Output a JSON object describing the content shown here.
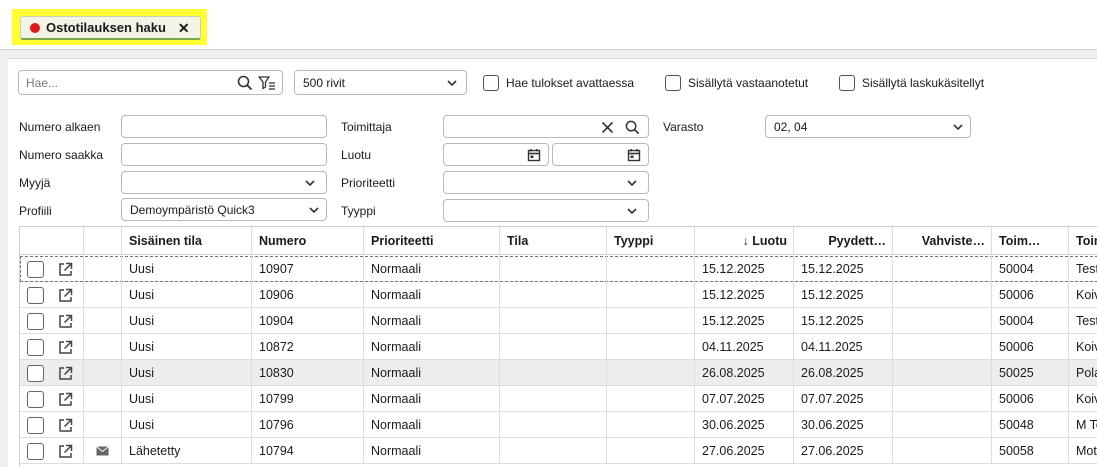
{
  "tab": {
    "label": "Ostotilauksen haku",
    "close": "✕"
  },
  "filters": {
    "search_placeholder": "Hae...",
    "rows_select": "500 rivit",
    "chk_fetch_on_open": "Hae tulokset avattaessa",
    "chk_include_received": "Sisällytä vastaanotetut",
    "chk_include_invoiced": "Sisällytä laskukäsitellyt",
    "number_from_label": "Numero alkaen",
    "number_to_label": "Numero saakka",
    "seller_label": "Myyjä",
    "profile_label": "Profiili",
    "profile_value": "Demoympäristö Quick3",
    "supplier_label": "Toimittaja",
    "created_label": "Luotu",
    "priority_label": "Prioriteetti",
    "type_label": "Tyyppi",
    "warehouse_label": "Varasto",
    "warehouse_value": "02, 04"
  },
  "table": {
    "headers": {
      "internal_status": "Sisäinen tila",
      "number": "Numero",
      "priority": "Prioriteetti",
      "status": "Tila",
      "type": "Tyyppi",
      "created": "↓ Luotu",
      "requested": "Pyydett…",
      "confirmed": "Vahviste…",
      "supplier_no": "Toim…",
      "supplier_name": "Toim"
    },
    "rows": [
      {
        "internal_status": "Uusi",
        "number": "10907",
        "priority": "Normaali",
        "created": "15.12.2025",
        "requested": "15.12.2025",
        "supplier_no": "50004",
        "supplier_name": "Test",
        "mail": false
      },
      {
        "internal_status": "Uusi",
        "number": "10906",
        "priority": "Normaali",
        "created": "15.12.2025",
        "requested": "15.12.2025",
        "supplier_no": "50006",
        "supplier_name": "Koiv",
        "mail": false
      },
      {
        "internal_status": "Uusi",
        "number": "10904",
        "priority": "Normaali",
        "created": "15.12.2025",
        "requested": "15.12.2025",
        "supplier_no": "50004",
        "supplier_name": "Test",
        "mail": false
      },
      {
        "internal_status": "Uusi",
        "number": "10872",
        "priority": "Normaali",
        "created": "04.11.2025",
        "requested": "04.11.2025",
        "supplier_no": "50006",
        "supplier_name": "Koiv",
        "mail": false
      },
      {
        "internal_status": "Uusi",
        "number": "10830",
        "priority": "Normaali",
        "created": "26.08.2025",
        "requested": "26.08.2025",
        "supplier_no": "50025",
        "supplier_name": "Pola",
        "mail": false
      },
      {
        "internal_status": "Uusi",
        "number": "10799",
        "priority": "Normaali",
        "created": "07.07.2025",
        "requested": "07.07.2025",
        "supplier_no": "50006",
        "supplier_name": "Koiv",
        "mail": false
      },
      {
        "internal_status": "Uusi",
        "number": "10796",
        "priority": "Normaali",
        "created": "30.06.2025",
        "requested": "30.06.2025",
        "supplier_no": "50048",
        "supplier_name": "M To",
        "mail": false
      },
      {
        "internal_status": "Lähetetty",
        "number": "10794",
        "priority": "Normaali",
        "created": "27.06.2025",
        "requested": "27.06.2025",
        "supplier_no": "50058",
        "supplier_name": "Moti",
        "mail": true
      }
    ]
  },
  "colors": {
    "highlight": "#ffff33",
    "status_dot": "#e01919",
    "tab_underline": "#7aa64a",
    "selected_row": "#eceeed"
  }
}
